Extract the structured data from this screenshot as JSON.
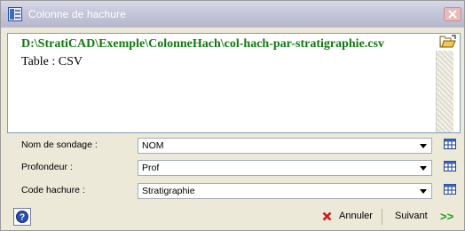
{
  "window": {
    "title": "Colonne de hachure"
  },
  "file": {
    "path": "D:\\StratiCAD\\Exemple\\ColonneHach\\col-hach-par-stratigraphie.csv",
    "table_line": "Table : CSV"
  },
  "fields": [
    {
      "label": "Nom de sondage :",
      "value": "NOM"
    },
    {
      "label": "Profondeur :",
      "value": "Prof"
    },
    {
      "label": "Code hachure :",
      "value": "Stratigraphie"
    }
  ],
  "buttons": {
    "cancel": "Annuler",
    "next": "Suivant",
    "next_arrows": ">>"
  },
  "colors": {
    "path_text": "#0f7a0f",
    "next_arrows": "#18a018",
    "cancel_x": "#d01818"
  },
  "icons": [
    "app-icon",
    "close-icon",
    "folder-open-icon",
    "table-icon",
    "help-icon",
    "cancel-x-icon",
    "next-arrows-icon"
  ]
}
